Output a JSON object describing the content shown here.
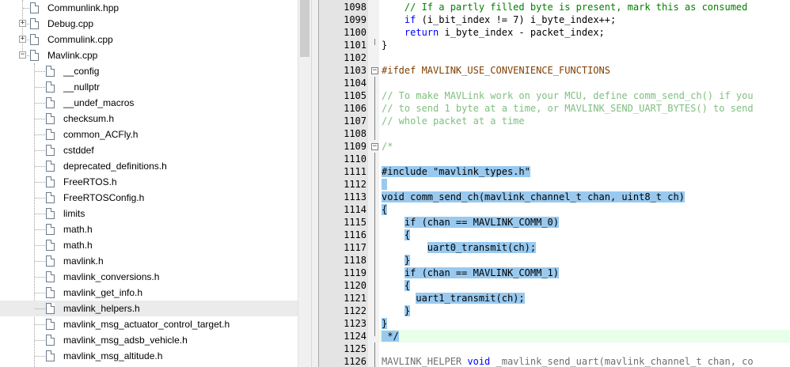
{
  "file_tree": {
    "items": [
      {
        "label": "Communlink.hpp",
        "level": 1,
        "expander": false
      },
      {
        "label": "Debug.cpp",
        "level": 1,
        "expander": "+"
      },
      {
        "label": "Commulink.cpp",
        "level": 1,
        "expander": "+"
      },
      {
        "label": "Mavlink.cpp",
        "level": 1,
        "expander": "-"
      },
      {
        "label": "__config",
        "level": 2,
        "expander": false
      },
      {
        "label": "__nullptr",
        "level": 2,
        "expander": false
      },
      {
        "label": "__undef_macros",
        "level": 2,
        "expander": false
      },
      {
        "label": "checksum.h",
        "level": 2,
        "expander": false
      },
      {
        "label": "common_ACFly.h",
        "level": 2,
        "expander": false
      },
      {
        "label": "cstddef",
        "level": 2,
        "expander": false
      },
      {
        "label": "deprecated_definitions.h",
        "level": 2,
        "expander": false
      },
      {
        "label": "FreeRTOS.h",
        "level": 2,
        "expander": false
      },
      {
        "label": "FreeRTOSConfig.h",
        "level": 2,
        "expander": false
      },
      {
        "label": "limits",
        "level": 2,
        "expander": false
      },
      {
        "label": "math.h",
        "level": 2,
        "expander": false
      },
      {
        "label": "math.h",
        "level": 2,
        "expander": false
      },
      {
        "label": "mavlink.h",
        "level": 2,
        "expander": false
      },
      {
        "label": "mavlink_conversions.h",
        "level": 2,
        "expander": false
      },
      {
        "label": "mavlink_get_info.h",
        "level": 2,
        "expander": false
      },
      {
        "label": "mavlink_helpers.h",
        "level": 2,
        "expander": false,
        "selected": true
      },
      {
        "label": "mavlink_msg_actuator_control_target.h",
        "level": 2,
        "expander": false
      },
      {
        "label": "mavlink_msg_adsb_vehicle.h",
        "level": 2,
        "expander": false
      },
      {
        "label": "mavlink_msg_altitude.h",
        "level": 2,
        "expander": false
      }
    ]
  },
  "editor": {
    "lines": [
      {
        "num": "1098",
        "indent": "    ",
        "parts": [
          {
            "t": "// If a partly filled byte is present, mark this as consumed",
            "c": "cm"
          }
        ]
      },
      {
        "num": "1099",
        "indent": "    ",
        "parts": [
          {
            "t": "if",
            "c": "kw"
          },
          {
            "t": " (i_bit_index != 7) i_byte_index++;"
          }
        ]
      },
      {
        "num": "1100",
        "indent": "    ",
        "parts": [
          {
            "t": "return",
            "c": "kw"
          },
          {
            "t": " i_byte_index - packet_index;"
          }
        ]
      },
      {
        "num": "1101",
        "indent": "",
        "parts": [
          {
            "t": "}"
          }
        ],
        "fold": "end"
      },
      {
        "num": "1102",
        "indent": "",
        "parts": []
      },
      {
        "num": "1103",
        "indent": "",
        "parts": [
          {
            "t": "#ifdef MAVLINK_USE_CONVENIENCE_FUNCTIONS",
            "c": "pp"
          }
        ],
        "fold": "-"
      },
      {
        "num": "1104",
        "indent": "",
        "parts": [],
        "fold": "line"
      },
      {
        "num": "1105",
        "indent": "",
        "parts": [
          {
            "t": "// To make MAVLink work on your MCU, define comm_send_ch() if you",
            "c": "cm-dim"
          }
        ],
        "fold": "line"
      },
      {
        "num": "1106",
        "indent": "",
        "parts": [
          {
            "t": "// to send 1 byte at a time, or MAVLINK_SEND_UART_BYTES() to send",
            "c": "cm-dim"
          }
        ],
        "fold": "line"
      },
      {
        "num": "1107",
        "indent": "",
        "parts": [
          {
            "t": "// whole packet at a time",
            "c": "cm-dim"
          }
        ],
        "fold": "line"
      },
      {
        "num": "1108",
        "indent": "",
        "parts": [],
        "fold": "line"
      },
      {
        "num": "1109",
        "indent": "",
        "parts": [
          {
            "t": "/*",
            "c": "cm-dim"
          }
        ],
        "fold": "-"
      },
      {
        "num": "1110",
        "indent": "",
        "parts": [],
        "fold": "line"
      },
      {
        "num": "1111",
        "indent": "",
        "sel": true,
        "parts": [
          {
            "t": "#include \"mavlink_types.h\""
          }
        ],
        "fold": "line"
      },
      {
        "num": "1112",
        "indent": "",
        "sel": true,
        "parts": [
          {
            "t": " "
          }
        ],
        "fold": "line"
      },
      {
        "num": "1113",
        "indent": "",
        "sel": true,
        "parts": [
          {
            "t": "void comm_send_ch(mavlink_channel_t chan, uint8_t ch)"
          }
        ],
        "fold": "line"
      },
      {
        "num": "1114",
        "indent": "",
        "sel": true,
        "parts": [
          {
            "t": "{"
          }
        ],
        "fold": "line"
      },
      {
        "num": "1115",
        "indent": "    ",
        "sel": true,
        "parts": [
          {
            "t": "if (chan == MAVLINK_COMM_0)"
          }
        ],
        "fold": "line"
      },
      {
        "num": "1116",
        "indent": "    ",
        "sel": true,
        "parts": [
          {
            "t": "{"
          }
        ],
        "fold": "line"
      },
      {
        "num": "1117",
        "indent": "        ",
        "sel": true,
        "parts": [
          {
            "t": "uart0_transmit(ch);"
          }
        ],
        "fold": "line"
      },
      {
        "num": "1118",
        "indent": "    ",
        "sel": true,
        "parts": [
          {
            "t": "}"
          }
        ],
        "fold": "line"
      },
      {
        "num": "1119",
        "indent": "    ",
        "sel": true,
        "parts": [
          {
            "t": "if (chan == MAVLINK_COMM_1)"
          }
        ],
        "fold": "line"
      },
      {
        "num": "1120",
        "indent": "    ",
        "sel": true,
        "parts": [
          {
            "t": "{"
          }
        ],
        "fold": "line"
      },
      {
        "num": "1121",
        "indent": "      ",
        "sel": true,
        "parts": [
          {
            "t": "uart1_transmit(ch);"
          }
        ],
        "fold": "line"
      },
      {
        "num": "1122",
        "indent": "    ",
        "sel": true,
        "parts": [
          {
            "t": "}"
          }
        ],
        "fold": "line"
      },
      {
        "num": "1123",
        "indent": "",
        "sel": true,
        "parts": [
          {
            "t": "}"
          }
        ],
        "fold": "line"
      },
      {
        "num": "1124",
        "indent": "",
        "sel": true,
        "current": true,
        "parts": [
          {
            "t": " */"
          }
        ],
        "fold": "end"
      },
      {
        "num": "1125",
        "indent": "",
        "parts": [],
        "fold": "line"
      },
      {
        "num": "1126",
        "indent": "",
        "parts": [
          {
            "t": "MAVLINK_HELPER ",
            "c": "macro"
          },
          {
            "t": "void",
            "c": "kw"
          },
          {
            "t": " _mavlink_send_uart(mavlink_channel_t chan, co",
            "c": "macro"
          }
        ],
        "fold": "line"
      }
    ]
  }
}
